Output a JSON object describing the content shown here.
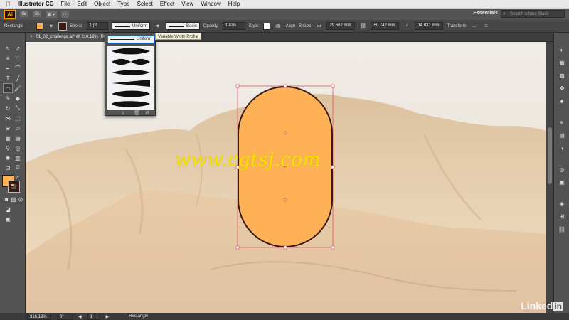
{
  "menubar": {
    "app": "Illustrator CC",
    "items": [
      "File",
      "Edit",
      "Object",
      "Type",
      "Select",
      "Effect",
      "View",
      "Window",
      "Help"
    ]
  },
  "appbar": {
    "logo": "Ai",
    "br": "Br",
    "st": "St",
    "workspace": "Essentials",
    "search_placeholder": "Search Adobe Stock"
  },
  "control": {
    "object_type": "Rectangle",
    "stroke_label": "Stroke:",
    "stroke_weight": "1 pt",
    "profile_value": "Uniform",
    "brush_value": "Basic",
    "opacity_label": "Opacity:",
    "opacity_value": "100%",
    "style_label": "Style:",
    "align_label": "Align",
    "shape_label": "Shape",
    "w_value": "29.662 mm",
    "h_value": "50.742 mm",
    "r_value": "14.831 mm",
    "transform_label": "Transform",
    "fill_color": "#ffb155",
    "stroke_color": "#3a1a14"
  },
  "doctab": {
    "title": "01_02_challenge.ai* @ 316.19% (RGB/P",
    "close": "×"
  },
  "flyout": {
    "selected": "Uniform",
    "tooltip": "Variable Width Profile"
  },
  "canvas": {
    "shape_fill": "#ffb155",
    "shape_stroke": "#3a1a14",
    "selection_color": "#e0566a"
  },
  "status": {
    "zoom": "316.19%",
    "angle": "0°",
    "page": "1",
    "tool": "Rectangle"
  },
  "watermark": "www.cgtsj.com",
  "brand": {
    "linked": "Linked",
    "in": "in"
  }
}
